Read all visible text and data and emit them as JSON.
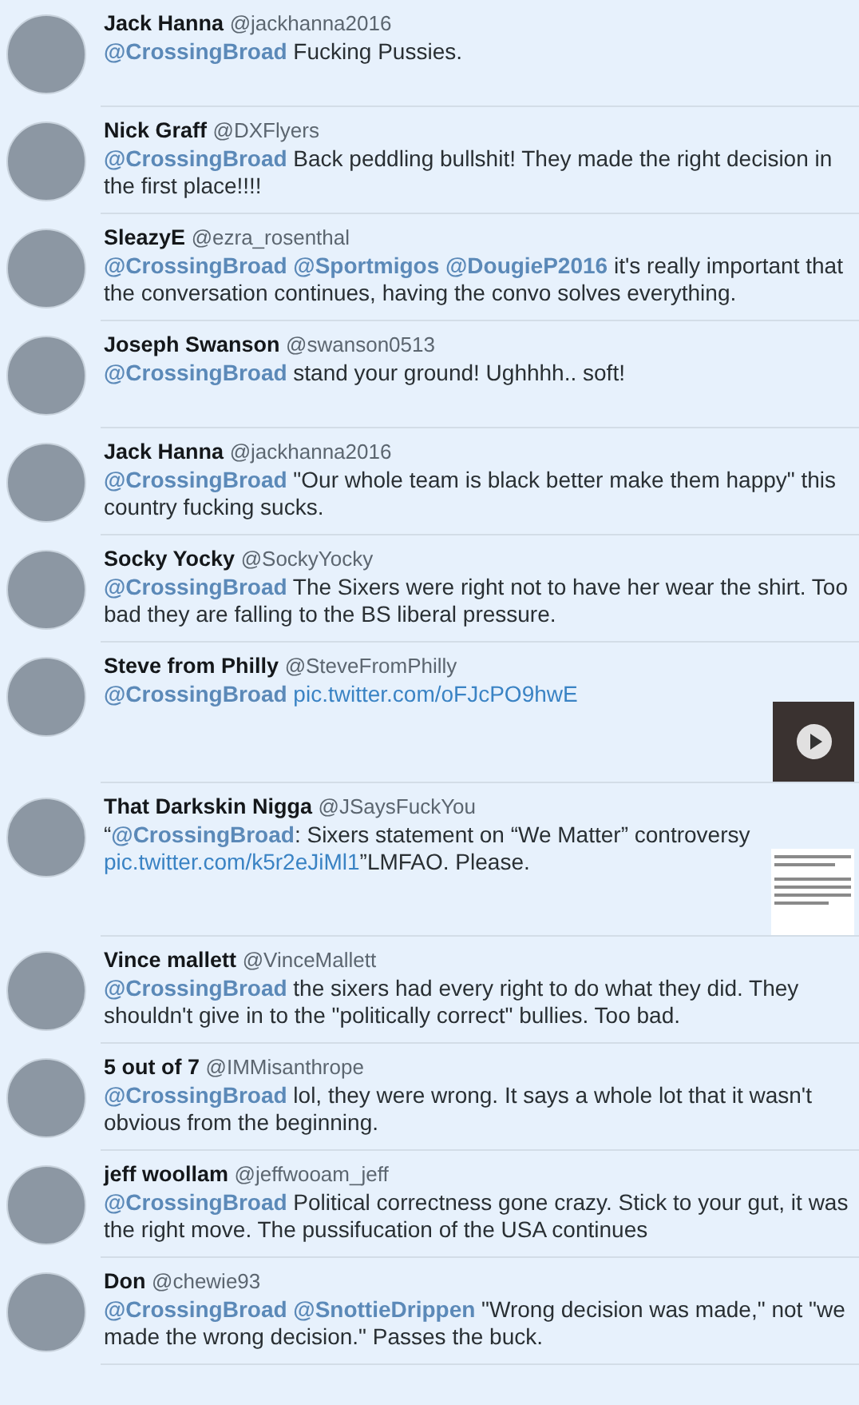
{
  "replies": [
    {
      "name": "Jack Hanna",
      "handle": "@jackhanna2016",
      "text": [
        {
          "kind": "mention",
          "text": "@CrossingBroad"
        },
        {
          "kind": "plain",
          "text": " Fucking Pussies."
        }
      ]
    },
    {
      "name": "Nick Graff",
      "handle": "@DXFlyers",
      "text": [
        {
          "kind": "mention",
          "text": "@CrossingBroad"
        },
        {
          "kind": "plain",
          "text": " Back peddling bullshit! They made the right decision in the first place!!!!"
        }
      ]
    },
    {
      "name": "SleazyE",
      "handle": "@ezra_rosenthal",
      "text": [
        {
          "kind": "mention",
          "text": "@CrossingBroad",
          "space_after": true
        },
        {
          "kind": "mention",
          "text": "@Sportmigos",
          "space_after": true
        },
        {
          "kind": "mention",
          "text": "@DougieP2016"
        },
        {
          "kind": "plain",
          "text": " it's really important that the conversation continues, having the convo solves everything."
        }
      ]
    },
    {
      "name": "Joseph Swanson",
      "handle": "@swanson0513",
      "text": [
        {
          "kind": "mention",
          "text": "@CrossingBroad"
        },
        {
          "kind": "plain",
          "text": " stand your ground! Ughhhh.. soft!"
        }
      ]
    },
    {
      "name": "Jack Hanna",
      "handle": "@jackhanna2016",
      "text": [
        {
          "kind": "mention",
          "text": "@CrossingBroad"
        },
        {
          "kind": "plain",
          "text": " \"Our whole team is black better make them happy\" this country fucking sucks."
        }
      ]
    },
    {
      "name": "Socky Yocky",
      "handle": "@SockyYocky",
      "text": [
        {
          "kind": "mention",
          "text": "@CrossingBroad"
        },
        {
          "kind": "plain",
          "text": " The Sixers were right not to have her wear the shirt. Too bad they are falling to the BS liberal pressure."
        }
      ]
    },
    {
      "name": "Steve from Philly",
      "handle": "@SteveFromPhilly",
      "text": [
        {
          "kind": "mention",
          "text": "@CrossingBroad",
          "space_after": true
        },
        {
          "kind": "link",
          "text": "pic.twitter.com/oFJcPO9hwE"
        }
      ],
      "media": {
        "kind": "video"
      }
    },
    {
      "name": "That Darkskin Nigga",
      "handle": "@JSaysFuckYou",
      "text": [
        {
          "kind": "plain",
          "text": "“"
        },
        {
          "kind": "mention",
          "text": "@CrossingBroad"
        },
        {
          "kind": "plain",
          "text": ": Sixers statement on “We Matter” controversy "
        },
        {
          "kind": "link",
          "text": "pic.twitter.com/k5r2eJiMl1"
        },
        {
          "kind": "plain",
          "text": "”LMFAO. Please."
        }
      ],
      "media": {
        "kind": "document"
      }
    },
    {
      "name": "Vince mallett",
      "handle": "@VinceMallett",
      "text": [
        {
          "kind": "mention",
          "text": "@CrossingBroad"
        },
        {
          "kind": "plain",
          "text": " the sixers had every right to do what they did. They shouldn't give in to the \"politically correct\" bullies. Too bad."
        }
      ]
    },
    {
      "name": "5 out of 7",
      "handle": "@IMMisanthrope",
      "text": [
        {
          "kind": "mention",
          "text": "@CrossingBroad"
        },
        {
          "kind": "plain",
          "text": " lol, they were wrong. It says a whole lot that it wasn't obvious from the beginning."
        }
      ]
    },
    {
      "name": "jeff woollam",
      "handle": "@jeffwooam_jeff",
      "text": [
        {
          "kind": "mention",
          "text": "@CrossingBroad"
        },
        {
          "kind": "plain",
          "text": " Political correctness gone crazy. Stick to your gut, it was the right move. The pussifucation of the USA continues"
        }
      ]
    },
    {
      "name": "Don",
      "handle": "@chewie93",
      "text": [
        {
          "kind": "mention",
          "text": "@CrossingBroad",
          "space_after": true
        },
        {
          "kind": "mention",
          "text": "@SnottieDrippen"
        },
        {
          "kind": "plain",
          "text": " \"Wrong decision was made,\" not \"we made the wrong decision.\" Passes the buck."
        }
      ]
    }
  ]
}
